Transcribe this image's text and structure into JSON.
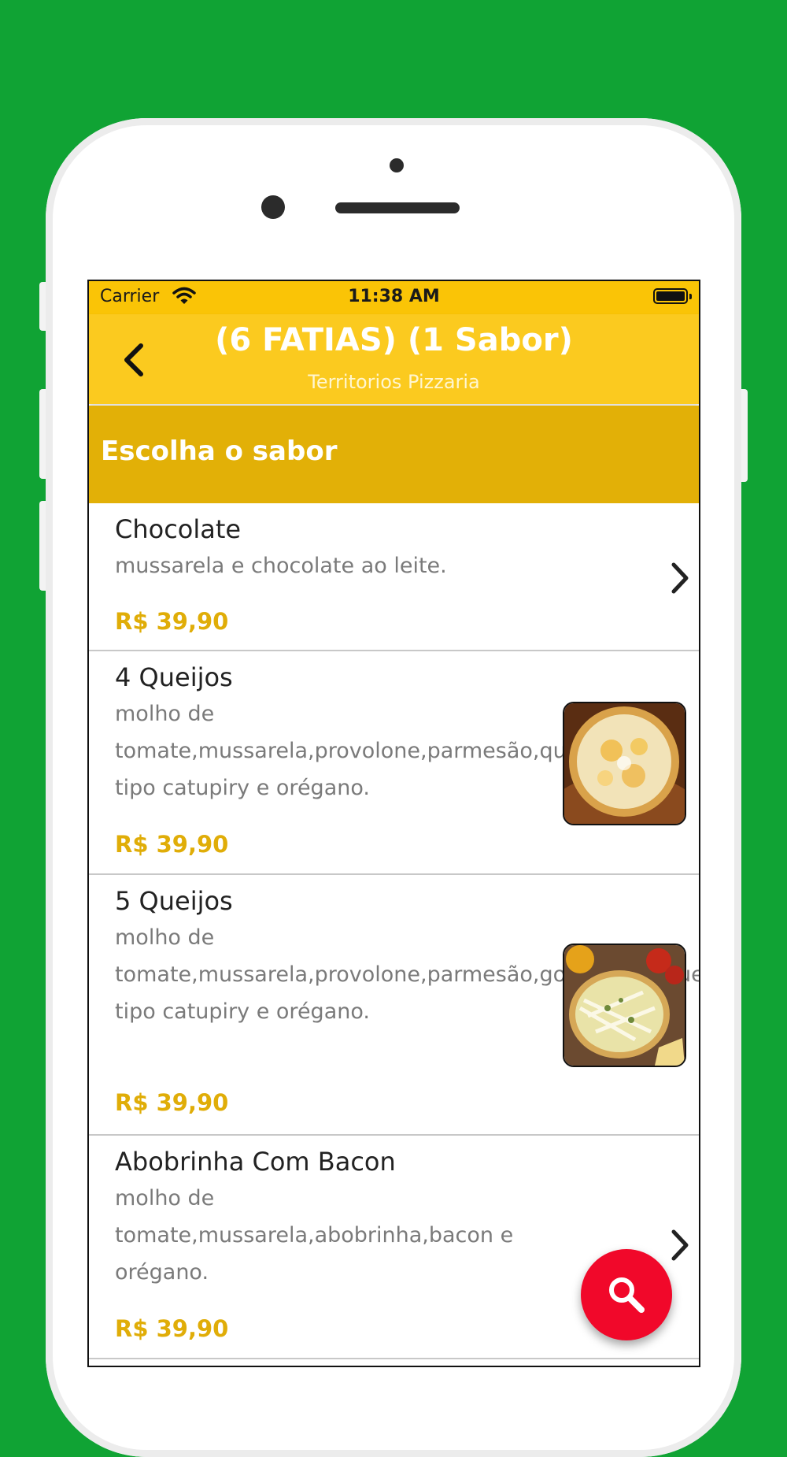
{
  "status_bar": {
    "carrier": "Carrier",
    "time": "11:38 AM",
    "wifi_icon": "wifi-icon",
    "battery_icon": "battery-icon"
  },
  "nav": {
    "title": "(6 FATIAS) (1 Sabor)",
    "subtitle": "Territorios Pizzaria",
    "back_icon": "chevron-left-icon"
  },
  "section": {
    "title": "Escolha o sabor"
  },
  "items": [
    {
      "name": "Chocolate",
      "description": "mussarela e chocolate ao leite.",
      "price": "R$ 39,90",
      "has_image": false
    },
    {
      "name": "4 Queijos",
      "description": "molho de tomate,mussarela,provolone,parmesão,queijo tipo catupiry e orégano.",
      "price": "R$ 39,90",
      "has_image": true
    },
    {
      "name": "5 Queijos",
      "description": "molho de tomate,mussarela,provolone,parmesão,gorgonzola,queijo tipo catupiry e orégano.",
      "price": "R$ 39,90",
      "has_image": true
    },
    {
      "name": "Abobrinha Com Bacon",
      "description": "molho de tomate,mussarela,abobrinha,bacon e orégano.",
      "price": "R$ 39,90",
      "has_image": false
    }
  ],
  "fab": {
    "icon": "search-icon"
  },
  "colors": {
    "background": "#10a334",
    "navbar": "#fbca1f",
    "section_header": "#e2b007",
    "price": "#e0ad08",
    "fab": "#f1082a"
  }
}
